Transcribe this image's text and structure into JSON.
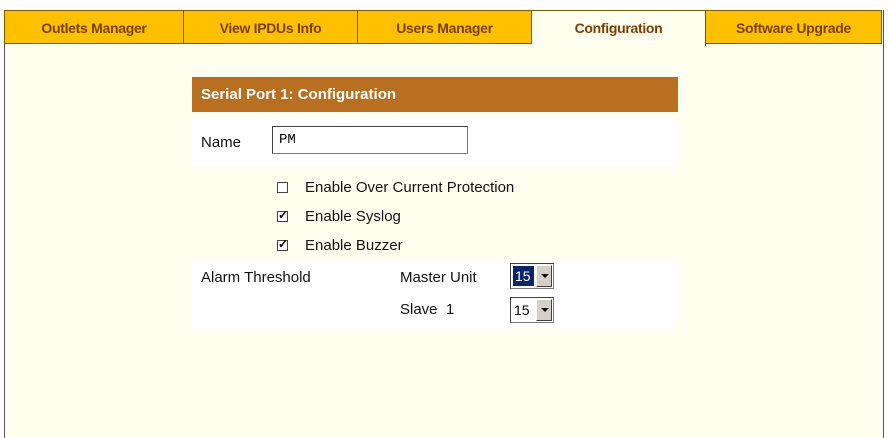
{
  "tabs": [
    {
      "label": "Outlets Manager",
      "active": false
    },
    {
      "label": "View IPDUs Info",
      "active": false
    },
    {
      "label": "Users Manager",
      "active": false
    },
    {
      "label": "Configuration",
      "active": true
    },
    {
      "label": "Software Upgrade",
      "active": false
    }
  ],
  "panel": {
    "title": "Serial Port 1: Configuration",
    "name_label": "Name",
    "name_value": "PM",
    "options": [
      {
        "label": "Enable Over Current Protection",
        "checked": false
      },
      {
        "label": "Enable Syslog",
        "checked": true
      },
      {
        "label": "Enable Buzzer",
        "checked": true
      }
    ],
    "alarm": {
      "label": "Alarm Threshold",
      "units": [
        {
          "label": "Master Unit",
          "value": "15",
          "focused": true
        },
        {
          "label": "Slave  1",
          "value": "15",
          "focused": false
        }
      ]
    }
  },
  "colors": {
    "tab_bg": "#ffc000",
    "tab_text": "#7a3e00",
    "header_bg": "#b87020",
    "page_bg": "#fffff0"
  }
}
